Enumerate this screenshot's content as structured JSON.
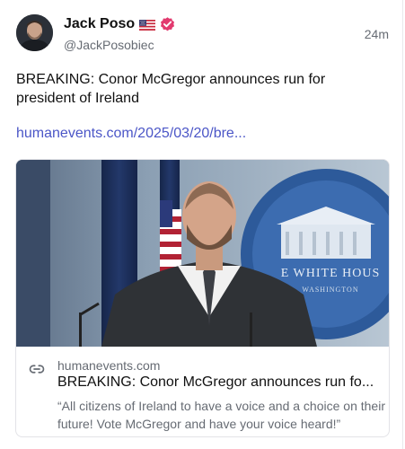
{
  "author": {
    "display_name": "Jack Poso",
    "handle": "@JackPosobiec"
  },
  "post": {
    "timestamp": "24m",
    "text": "BREAKING: Conor McGregor announces run for president of Ireland",
    "link_text": "humanevents.com/2025/03/20/bre..."
  },
  "card": {
    "domain": "humanevents.com",
    "title": "BREAKING: Conor McGregor announces run fo...",
    "description": "“All citizens of Ireland to have a voice and a choice on their future! Vote McGregor and have your voice heard!”",
    "image_sign_text": "E WHITE HOUS",
    "image_sign_subtext": "WASHINGTON"
  },
  "icons": {
    "flag": "us-flag-icon",
    "verified": "verified-badge-icon",
    "link": "link-icon"
  },
  "colors": {
    "link": "#4b56c7",
    "verified_badge": "#e23a6f",
    "muted_text": "#666b73"
  }
}
